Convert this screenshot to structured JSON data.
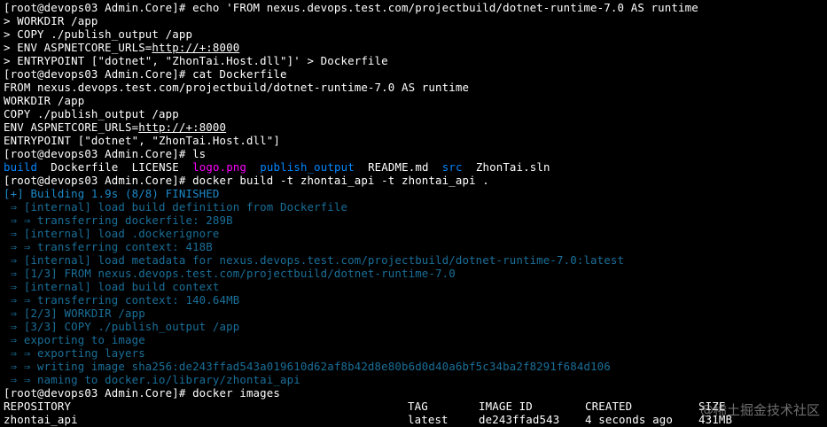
{
  "terminal": {
    "lines": [
      {
        "a": "[root@devops03 Admin.Core]# echo 'FROM nexus.devops.test.com/projectbuild/dotnet-runtime-7.0 AS runtime"
      },
      {
        "a": "> WORKDIR /app"
      },
      {
        "a": "> COPY ./publish_output /app"
      },
      {
        "a": "> ENV ASPNETCORE_URLS=",
        "b": "http://+:8000"
      },
      {
        "a": "> ENTRYPOINT [\"dotnet\", \"ZhonTai.Host.dll\"]' > Dockerfile"
      },
      {
        "a": "[root@devops03 Admin.Core]# cat Dockerfile"
      },
      {
        "a": "FROM nexus.devops.test.com/projectbuild/dotnet-runtime-7.0 AS runtime"
      },
      {
        "a": "WORKDIR /app"
      },
      {
        "a": "COPY ./publish_output /app"
      },
      {
        "a": "ENV ASPNETCORE_URLS=",
        "b": "http://+:8000"
      },
      {
        "a": "ENTRYPOINT [\"dotnet\", \"ZhonTai.Host.dll\"]"
      },
      {
        "a": "[root@devops03 Admin.Core]# ls"
      },
      {
        "ls": true
      },
      {
        "a": "[root@devops03 Admin.Core]# docker build -t zhontai_api -t zhontai_api ."
      },
      {
        "a": "[+] Building 1.9s (8/8) FINISHED"
      },
      {
        "a": " ⇒ [internal] load build definition from Dockerfile"
      },
      {
        "a": " ⇒ ⇒ transferring dockerfile: 289B"
      },
      {
        "a": " ⇒ [internal] load .dockerignore"
      },
      {
        "a": " ⇒ ⇒ transferring context: 418B"
      },
      {
        "a": " ⇒ [internal] load metadata for nexus.devops.test.com/projectbuild/dotnet-runtime-7.0:latest"
      },
      {
        "a": " ⇒ [1/3] FROM nexus.devops.test.com/projectbuild/dotnet-runtime-7.0"
      },
      {
        "a": " ⇒ [internal] load build context"
      },
      {
        "a": " ⇒ ⇒ transferring context: 140.64MB"
      },
      {
        "a": " ⇒ [2/3] WORKDIR /app"
      },
      {
        "a": " ⇒ [3/3] COPY ./publish_output /app"
      },
      {
        "a": " ⇒ exporting to image"
      },
      {
        "a": " ⇒ ⇒ exporting layers"
      },
      {
        "a": " ⇒ ⇒ writing image sha256:de243ffad543a019610d62af8b42d8e80b6d0d40a6bf5c34ba2f8291f684d106"
      },
      {
        "a": " ⇒ ⇒ naming to docker.io/library/zhontai_api"
      },
      {
        "a": "[root@devops03 Admin.Core]# docker images"
      },
      {
        "table": "header"
      },
      {
        "table": "row"
      }
    ],
    "ls_entries": [
      {
        "name": "build",
        "color": "blue"
      },
      {
        "name": "Dockerfile",
        "color": "white"
      },
      {
        "name": "LICENSE",
        "color": "white"
      },
      {
        "name": "logo.png",
        "color": "mag"
      },
      {
        "name": "publish_output",
        "color": "blue"
      },
      {
        "name": "README.md",
        "color": "white"
      },
      {
        "name": "src",
        "color": "blue"
      },
      {
        "name": "ZhonTai.sln",
        "color": "white"
      }
    ],
    "images_table": {
      "header": [
        "REPOSITORY",
        "TAG",
        "IMAGE ID",
        "CREATED",
        "SIZE"
      ],
      "row": [
        "zhontai_api",
        "latest",
        "de243ffad543",
        "4 seconds ago",
        "431MB"
      ]
    },
    "colors": {
      "background": "#000000",
      "text": "#ffffff",
      "dir_blue": "#0087ff",
      "image_magenta": "#ff00ff",
      "build_blue": "#1d89c9",
      "step_blue": "#1a6f99"
    }
  },
  "watermark": "@稀土掘金技术社区"
}
